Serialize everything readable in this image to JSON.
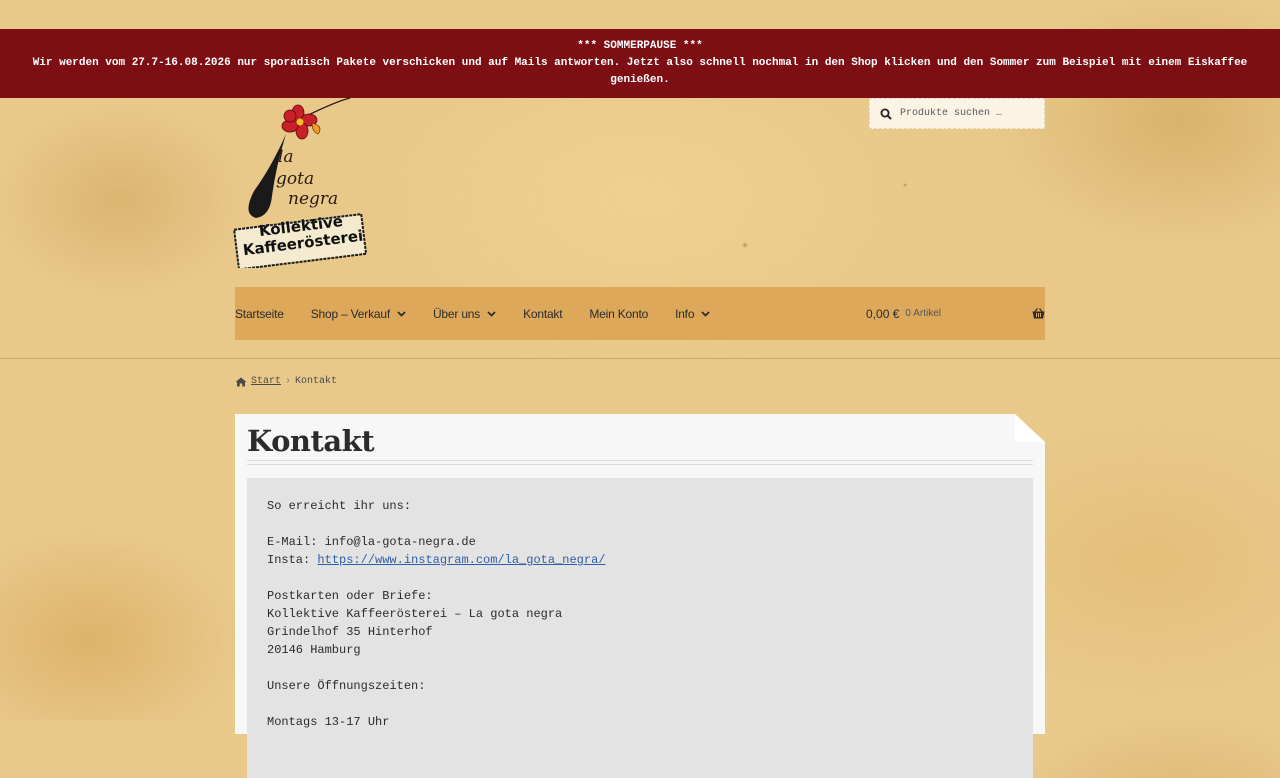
{
  "banner": {
    "title": "*** SOMMERPAUSE ***",
    "line1": "Wir werden vom 27.7-16.08.2026 nur sporadisch Pakete verschicken und auf Mails antworten. Jetzt also schnell nochmal in den Shop klicken und den Sommer zum Beispiel mit einem Eiskaffee",
    "line2": "genießen."
  },
  "logo": {
    "name_text": "la gota negra",
    "subtitle_line1": "Kollektive",
    "subtitle_line2": "Kaffeerösterei"
  },
  "search": {
    "placeholder": "Produkte suchen …",
    "icon": "search-icon"
  },
  "nav": {
    "items": [
      {
        "label": "Startseite",
        "has_dropdown": false
      },
      {
        "label": "Shop – Verkauf",
        "has_dropdown": true
      },
      {
        "label": "Über uns",
        "has_dropdown": true
      },
      {
        "label": "Kontakt",
        "has_dropdown": false
      },
      {
        "label": "Mein Konto",
        "has_dropdown": false
      },
      {
        "label": "Info",
        "has_dropdown": true
      }
    ],
    "cart": {
      "price": "0,00 €",
      "count": "0 Artikel",
      "icon": "basket-icon"
    }
  },
  "breadcrumb": {
    "home_label": "Start",
    "separator": "›",
    "current": "Kontakt"
  },
  "page": {
    "title": "Kontakt",
    "intro": "So erreicht ihr uns:",
    "email_line": "E-Mail: info@la-gota-negra.de",
    "insta_label": "Insta: ",
    "insta_link": "https://www.instagram.com/la_gota_negra/",
    "post_heading": "Postkarten oder Briefe:",
    "address1": "Kollektive Kaffeerösterei – La gota negra",
    "address2": "Grindelhof 35 Hinterhof",
    "address3": "20146 Hamburg",
    "hours_heading": "Unsere Öffnungszeiten:",
    "hours1": "Montags 13-17 Uhr"
  },
  "colors": {
    "banner": "#7d0f14",
    "nav": "#dda85a",
    "link": "#2c5fa8"
  }
}
